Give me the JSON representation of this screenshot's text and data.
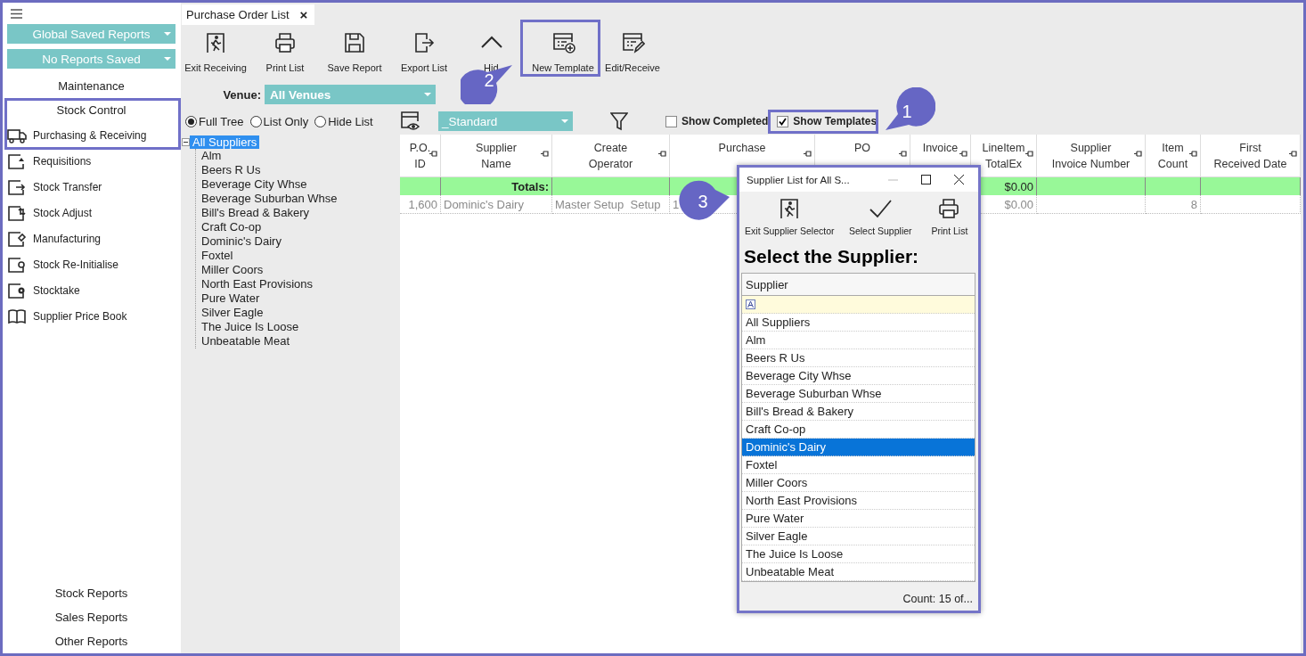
{
  "sidebar": {
    "dropdowns": [
      {
        "label": "Global Saved Reports"
      },
      {
        "label": "No Reports Saved"
      }
    ],
    "sections": [
      {
        "label": "Maintenance"
      },
      {
        "label": "Stock Control"
      }
    ],
    "items": [
      {
        "label": "Purchasing & Receiving",
        "kind": "truck"
      },
      {
        "label": "Requisitions",
        "kind": "requisition"
      },
      {
        "label": "Stock Transfer",
        "kind": "transfer"
      },
      {
        "label": "Stock Adjust",
        "kind": "adjust"
      },
      {
        "label": "Manufacturing",
        "kind": "manufacturing"
      },
      {
        "label": "Stock Re-Initialise",
        "kind": "reinit"
      },
      {
        "label": "Stocktake",
        "kind": "stocktake"
      },
      {
        "label": "Supplier Price Book",
        "kind": "book"
      }
    ],
    "reports": [
      {
        "label": "Stock Reports"
      },
      {
        "label": "Sales Reports"
      },
      {
        "label": "Other Reports"
      }
    ]
  },
  "tab": {
    "title": "Purchase Order List",
    "close": "×"
  },
  "toolbar": [
    {
      "label": "Exit Receiving",
      "kind": "exit"
    },
    {
      "label": "Print List",
      "kind": "print"
    },
    {
      "label": "Save Report",
      "kind": "save"
    },
    {
      "label": "Export List",
      "kind": "export"
    },
    {
      "label": "Hid",
      "kind": "hide"
    },
    {
      "label": "New Template",
      "kind": "new_template"
    },
    {
      "label": "Edit/Receive",
      "kind": "edit"
    }
  ],
  "venue": {
    "label": "Venue:",
    "value": "All Venues"
  },
  "view_options": [
    {
      "label": "Full Tree",
      "selected": true
    },
    {
      "label": "List Only",
      "selected": false
    },
    {
      "label": "Hide List",
      "selected": false
    }
  ],
  "layout": {
    "value": "_Standard"
  },
  "checkboxes": [
    {
      "label": "Show Completed",
      "checked": false
    },
    {
      "label": "Show Templates",
      "checked": true
    }
  ],
  "tree": {
    "label": "All Suppliers",
    "selected": true,
    "expanded": true,
    "children": [
      {
        "label": "Alm"
      },
      {
        "label": "Beers R Us"
      },
      {
        "label": "Beverage City Whse"
      },
      {
        "label": "Beverage Suburban Whse"
      },
      {
        "label": "Bill's Bread & Bakery"
      },
      {
        "label": "Craft Co-op"
      },
      {
        "label": "Dominic's Dairy"
      },
      {
        "label": "Foxtel"
      },
      {
        "label": "Miller Coors"
      },
      {
        "label": "North East Provisions"
      },
      {
        "label": "Pure Water"
      },
      {
        "label": "Silver Eagle"
      },
      {
        "label": "The Juice Is Loose"
      },
      {
        "label": "Unbeatable Meat"
      }
    ]
  },
  "table": {
    "columns": [
      {
        "lines": [
          "P.O.",
          "ID"
        ]
      },
      {
        "lines": [
          "Supplier",
          "Name"
        ]
      },
      {
        "lines": [
          "Create",
          "Operator"
        ]
      },
      {
        "lines": [
          "Purchase"
        ]
      },
      {
        "lines": [
          "PO"
        ]
      },
      {
        "lines": [
          "Invoice"
        ]
      },
      {
        "lines": [
          "LineItem",
          "TotalEx"
        ]
      },
      {
        "lines": [
          "Supplier",
          "Invoice Number"
        ]
      },
      {
        "lines": [
          "Item",
          "Count"
        ]
      },
      {
        "lines": [
          "First",
          "Received Date"
        ]
      }
    ],
    "totals_row": {
      "label": "Totals:",
      "amount": "$0.00"
    },
    "rows": [
      [
        "1,600",
        "Dominic's Dairy",
        "Master Setup  Setup",
        "1",
        "",
        "",
        "$0.00",
        "",
        "8",
        ""
      ]
    ]
  },
  "dialog": {
    "title": "Supplier List for All S...",
    "toolbar": [
      {
        "label": "Exit Supplier Selector",
        "kind": "exit"
      },
      {
        "label": "Select Supplier",
        "kind": "check"
      },
      {
        "label": "Print List",
        "kind": "print"
      }
    ],
    "heading": "Select the Supplier:",
    "column": "Supplier",
    "items": [
      {
        "label": "All Suppliers",
        "selected": false
      },
      {
        "label": "Alm",
        "selected": false
      },
      {
        "label": "Beers R Us",
        "selected": false
      },
      {
        "label": "Beverage City Whse",
        "selected": false
      },
      {
        "label": "Beverage Suburban Whse",
        "selected": false
      },
      {
        "label": "Bill's Bread & Bakery",
        "selected": false
      },
      {
        "label": "Craft Co-op",
        "selected": false
      },
      {
        "label": "Dominic's Dairy",
        "selected": true
      },
      {
        "label": "Foxtel",
        "selected": false
      },
      {
        "label": "Miller Coors",
        "selected": false
      },
      {
        "label": "North East Provisions",
        "selected": false
      },
      {
        "label": "Pure Water",
        "selected": false
      },
      {
        "label": "Silver Eagle",
        "selected": false
      },
      {
        "label": "The Juice Is Loose",
        "selected": false
      },
      {
        "label": "Unbeatable Meat",
        "selected": false
      }
    ],
    "footer": "Count: 15 of..."
  },
  "callouts": [
    {
      "number": "1"
    },
    {
      "number": "2"
    },
    {
      "number": "3"
    }
  ]
}
